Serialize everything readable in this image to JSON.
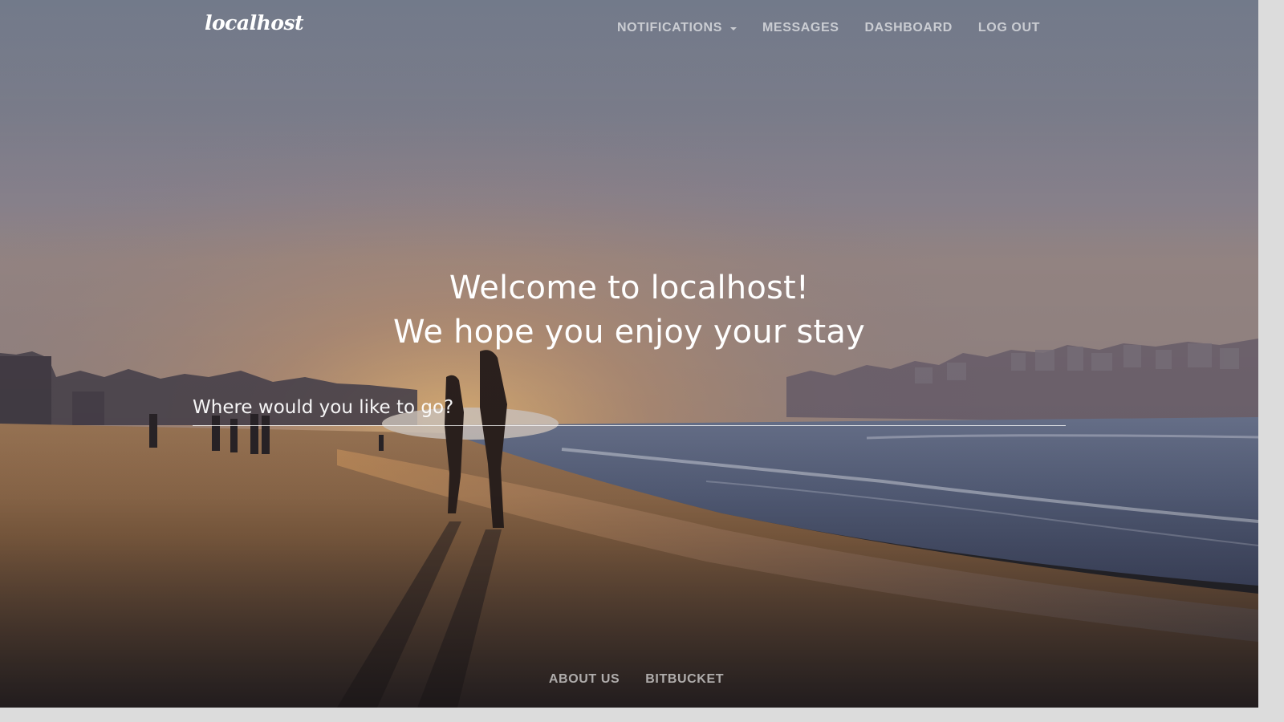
{
  "navbar": {
    "brand": "localhost",
    "links": [
      {
        "label": "NOTIFICATIONS",
        "dropdown": true
      },
      {
        "label": "MESSAGES"
      },
      {
        "label": "DASHBOARD"
      },
      {
        "label": "LOG OUT"
      }
    ]
  },
  "hero": {
    "line1": "Welcome to localhost!",
    "line2": "We hope you enjoy your stay"
  },
  "search": {
    "placeholder": "Where would you like to go?",
    "value": ""
  },
  "footer": {
    "links": [
      {
        "label": "ABOUT US"
      },
      {
        "label": "BITBUCKET"
      }
    ]
  },
  "colors": {
    "text": "#ffffff",
    "nav_text": "#c9c5c8",
    "sky": "#7d7d8c",
    "sand": "#8a6747",
    "sun_glow": "#e9a24f"
  }
}
